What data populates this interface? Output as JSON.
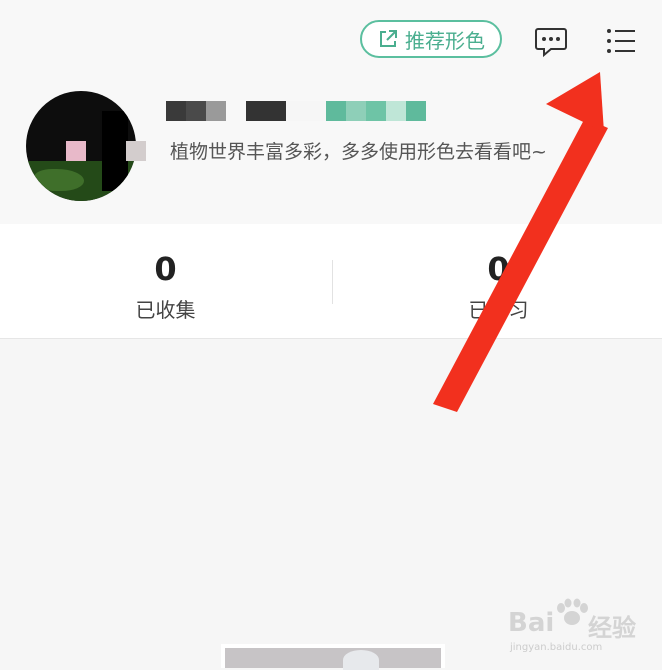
{
  "header": {
    "recommend_label": "推荐形色",
    "icons": {
      "share": "share-external-icon",
      "message": "message-bubble-icon",
      "menu": "list-menu-icon"
    },
    "accent_color": "#4aae8f"
  },
  "profile": {
    "bio": "植物世界丰富多彩，多多使用形色去看看吧~"
  },
  "stats": [
    {
      "value": "0",
      "label": "已收集"
    },
    {
      "value": "0",
      "label": "已学习"
    }
  ],
  "watermark": {
    "brand": "Bai",
    "product": "经验",
    "url": "jingyan.baidu.com"
  },
  "annotation": {
    "arrow_color": "#f2301e"
  }
}
